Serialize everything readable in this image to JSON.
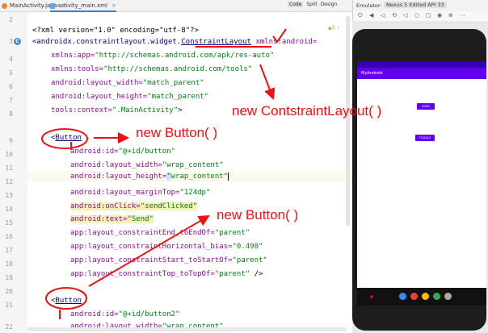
{
  "tabs": [
    {
      "label": "MainActivity.java",
      "active": false
    },
    {
      "label": "activity_main.xml",
      "active": true
    }
  ],
  "view_modes": [
    "Code",
    "Split",
    "Design"
  ],
  "emulator": {
    "label": "Emulator:",
    "device": "Nexus 5 Edited API 33",
    "app_title": "MyAndroid",
    "buttons": [
      "SEND",
      "TOGGLE"
    ]
  },
  "line_numbers": [
    "2",
    "3",
    "4",
    "5",
    "6",
    "7",
    "8",
    "9",
    "10",
    "11",
    "12",
    "13",
    "14",
    "15",
    "16",
    "17",
    "18",
    "19",
    "20",
    "21",
    "22"
  ],
  "warning": "▲3 ✓",
  "code": {
    "l1_decl": "<?xml version=\"1.0\" encoding=\"utf-8\"?>",
    "l2_open": "<androidx.constraintlayout.widget.",
    "l2_class": "ConstraintLayout",
    "l2_attr": " xmlns:android=",
    "l3_attr": "xmlns:app=",
    "l3_val": "\"http://schemas.android.com/apk/res-auto\"",
    "l4_attr": "xmlns:tools=",
    "l4_val": "\"http://schemas.android.com/tools\"",
    "l5_attr": "android:layout_width=",
    "l5_val": "\"match_parent\"",
    "l6_attr": "android:layout_height=",
    "l6_val": "\"match_parent\"",
    "l7_attr": "tools:context=",
    "l7_val": "\".MainActivity\"",
    "l7_end": ">",
    "b1_lt": "<",
    "b1_tag": "Button",
    "b1_id_attr": "android:id=",
    "b1_id_val": "\"@+id/button\"",
    "b1_w_attr": "android:layout_width=",
    "b1_w_val": "\"wrap_content\"",
    "b1_h_attr": "android:layout_height=",
    "b1_h_q": "\"",
    "b1_h_val": "wrap_content\"",
    "b1_mt_attr": "android:layout_marginTop=",
    "b1_mt_val": "\"124dp\"",
    "b1_click_attr": "android:onClick=",
    "b1_click_val": "\"sendClicked\"",
    "b1_text_attr": "android:text=",
    "b1_text_val": "\"Send\"",
    "b1_c1_attr": "app:layout_constraintEnd_toEndOf=",
    "b1_c1_val": "\"parent\"",
    "b1_c2_attr": "app:layout_constraintHorizontal_bias=",
    "b1_c2_val": "\"0.498\"",
    "b1_c3_attr": "app:layout_constraintStart_toStartOf=",
    "b1_c3_val": "\"parent\"",
    "b1_c4_attr": "app:layout_constraintTop_toTopOf=",
    "b1_c4_val": "\"parent\"",
    "b1_close": " />",
    "b2_lt": "<",
    "b2_tag": "Button",
    "b2_id_attr": "android:id=",
    "b2_id_val": "\"@+id/button2\"",
    "b2_w_attr": "android:layout_width=",
    "b2_w_val": "\"wrap_content\""
  },
  "annotations": {
    "new_layout": "new ContstraintLayout( )",
    "new_button_1": "new Button( )",
    "new_button_2": "new Button( )"
  },
  "colors": {
    "annotation": "#ee1111",
    "tag": "#000080",
    "attribute": "#871094",
    "value": "#067d17",
    "android_purple": "#6200ee"
  }
}
